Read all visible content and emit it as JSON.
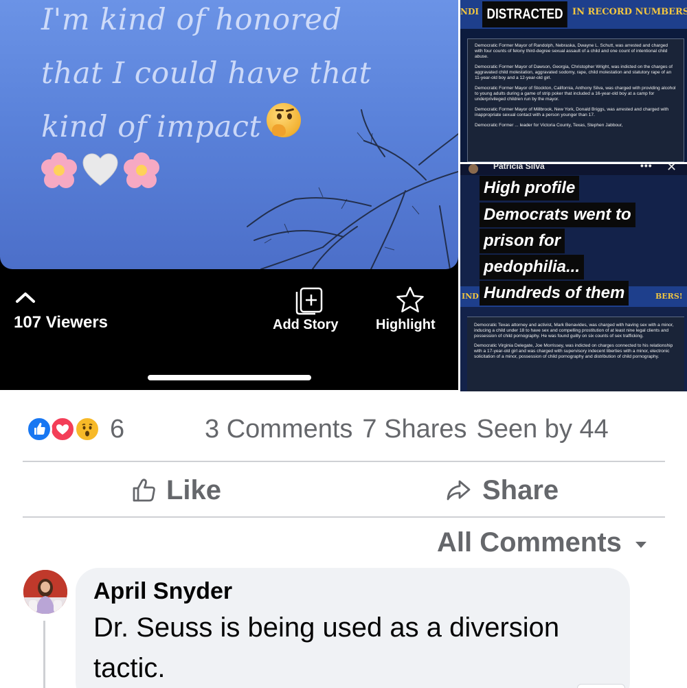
{
  "story": {
    "lines": [
      "I'm kind of honored",
      "that I could have that",
      "kind of impact"
    ],
    "emoji_thinking": "thinking-face-icon",
    "emoji_row": [
      "cherry-blossom-icon",
      "white-heart-icon",
      "cherry-blossom-icon"
    ],
    "viewers_label": "107 Viewers",
    "add_story_label": "Add Story",
    "highlight_label": "Highlight"
  },
  "image_top_right": {
    "banner_left": "NDI",
    "banner_center": "DISTRACTED",
    "banner_right": "IN RECORD NUMBERS",
    "paragraphs": [
      "Democratic Former Mayor of Randolph, Nebraska, Dwayne L. Schutt, was arrested and charged with four counts of felony third-degree sexual assault of a child and one count of intentional child abuse.",
      "Democratic Former Mayor of Dawson, Georgia, Christopher Wright, was indicted on the charges of aggravated child molestation, aggravated sodomy, rape, child molestation and statutory rape of an 11-year-old boy and a 12-year-old girl.",
      "Democratic Former Mayor of Stockton, California, Anthony Silva, was charged with providing alcohol to young adults during a game of strip poker that included a 16-year-old boy at a camp for underprivileged children run by the mayor.",
      "Democratic Former Mayor of Millbrook, New York, Donald Briggs, was arrested and charged with inappropriate sexual contact with a person younger than 17.",
      "Democratic Former ... leader for Victoria County, Texas, Stephen Jabbour,"
    ]
  },
  "image_bottom_right": {
    "poster_name": "Patricia Silva",
    "headline_lines": [
      "High profile",
      "Democrats went to",
      "prison for",
      "pedophilia...",
      "Hundreds of them"
    ],
    "band_left": "IND",
    "band_right": "BERS!",
    "paragraphs": [
      "Democratic Texas attorney and activist, Mark Benavides, was charged with having sex with a minor, inducing a child under 18 to have sex and compelling prostitution of at least nine legal clients and possession of child pornography. He was found guilty on six counts of sex trafficking.",
      "Democratic Virginia Delegate, Joe Morrissey, was indicted on charges connected to his relationship with a 17-year-old girl and was charged with supervisory indecent liberties with a minor, electronic solicitation of a minor, possession of child pornography and distribution of child pornography."
    ]
  },
  "post_stats": {
    "reaction_icons": [
      "like-reaction-icon",
      "love-reaction-icon",
      "wow-reaction-icon"
    ],
    "reaction_count": "6",
    "comments": "3 Comments",
    "shares": "7 Shares",
    "seen_by": "Seen by 44"
  },
  "actions": {
    "like_label": "Like",
    "share_label": "Share"
  },
  "comments_filter": {
    "label": "All Comments"
  },
  "comment": {
    "author": "April Snyder",
    "text": "Dr. Seuss is being used as a diversion tactic."
  },
  "colors": {
    "like_blue": "#1877f2",
    "love_red": "#f33e58",
    "wow_yellow": "#f7b928",
    "secondary_text": "#65676b",
    "bubble_bg": "#f0f2f5"
  }
}
